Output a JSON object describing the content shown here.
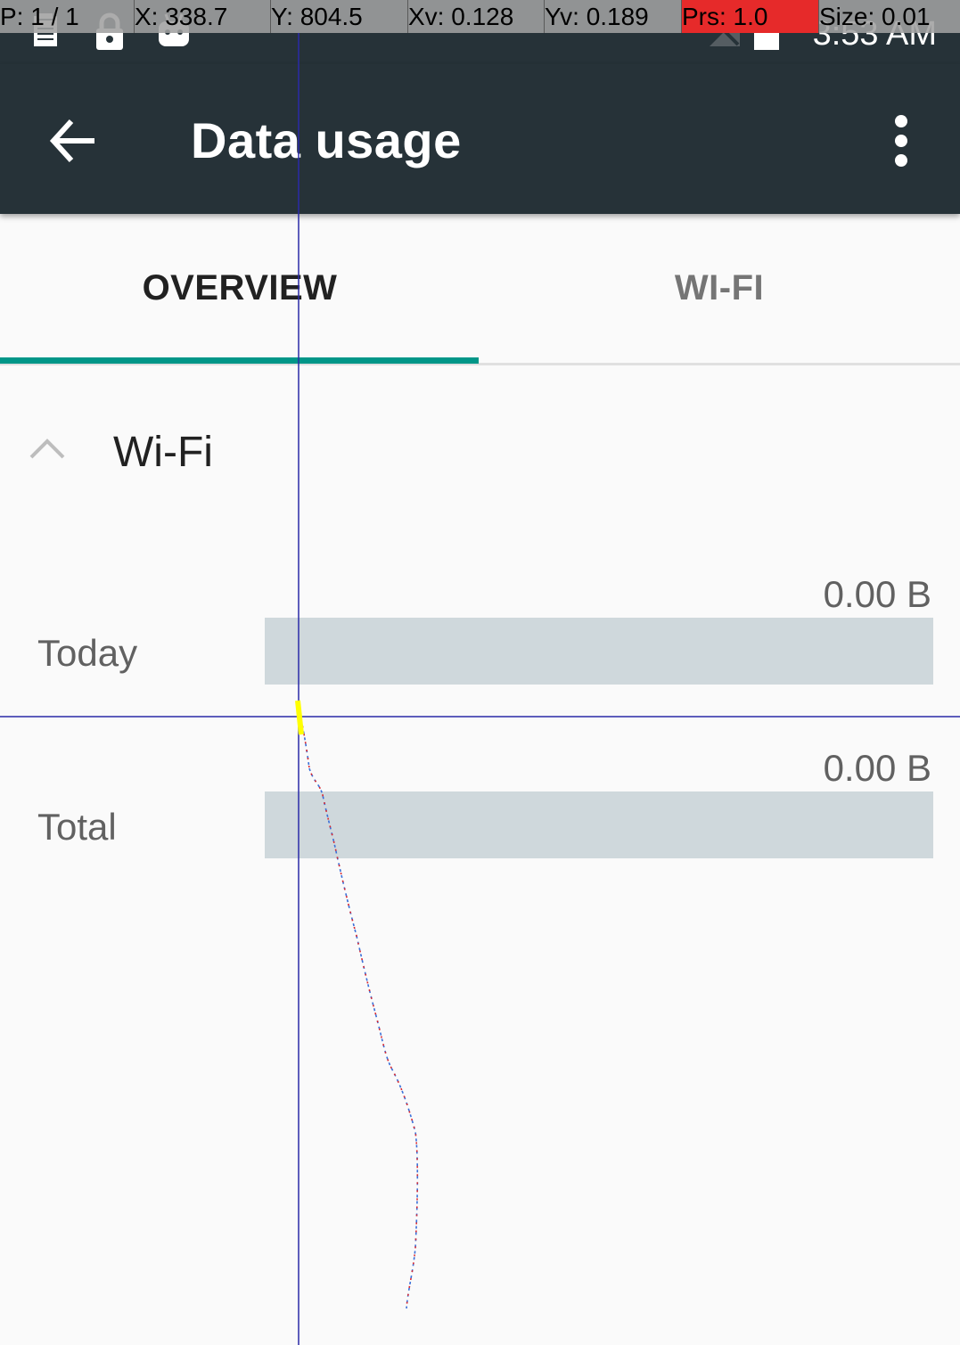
{
  "pointer_overlay": {
    "pointer": "P: 1 / 1",
    "x": "X: 338.7",
    "y": "Y: 804.5",
    "xv": "Xv: 0.128",
    "yv": "Yv: 0.189",
    "pressure": "Prs: 1.0",
    "size": "Size: 0.01",
    "pressure_color": "#e62a2a"
  },
  "status_bar": {
    "time": "3:53 AM",
    "icons": [
      "log-icon",
      "lock-icon",
      "android-icon",
      "no-signal-icon",
      "battery-icon"
    ]
  },
  "app_bar": {
    "title": "Data usage",
    "back_icon": "arrow-back-icon",
    "menu_icon": "more-vert-icon"
  },
  "tabs": [
    {
      "label": "OVERVIEW",
      "selected": true
    },
    {
      "label": "WI-FI",
      "selected": false
    }
  ],
  "accent_color": "#009688",
  "section": {
    "title": "Wi-Fi",
    "expanded": true,
    "rows": [
      {
        "label": "Today",
        "value": "0.00 B",
        "fraction": 0
      },
      {
        "label": "Total",
        "value": "0.00 B",
        "fraction": 0
      }
    ]
  }
}
